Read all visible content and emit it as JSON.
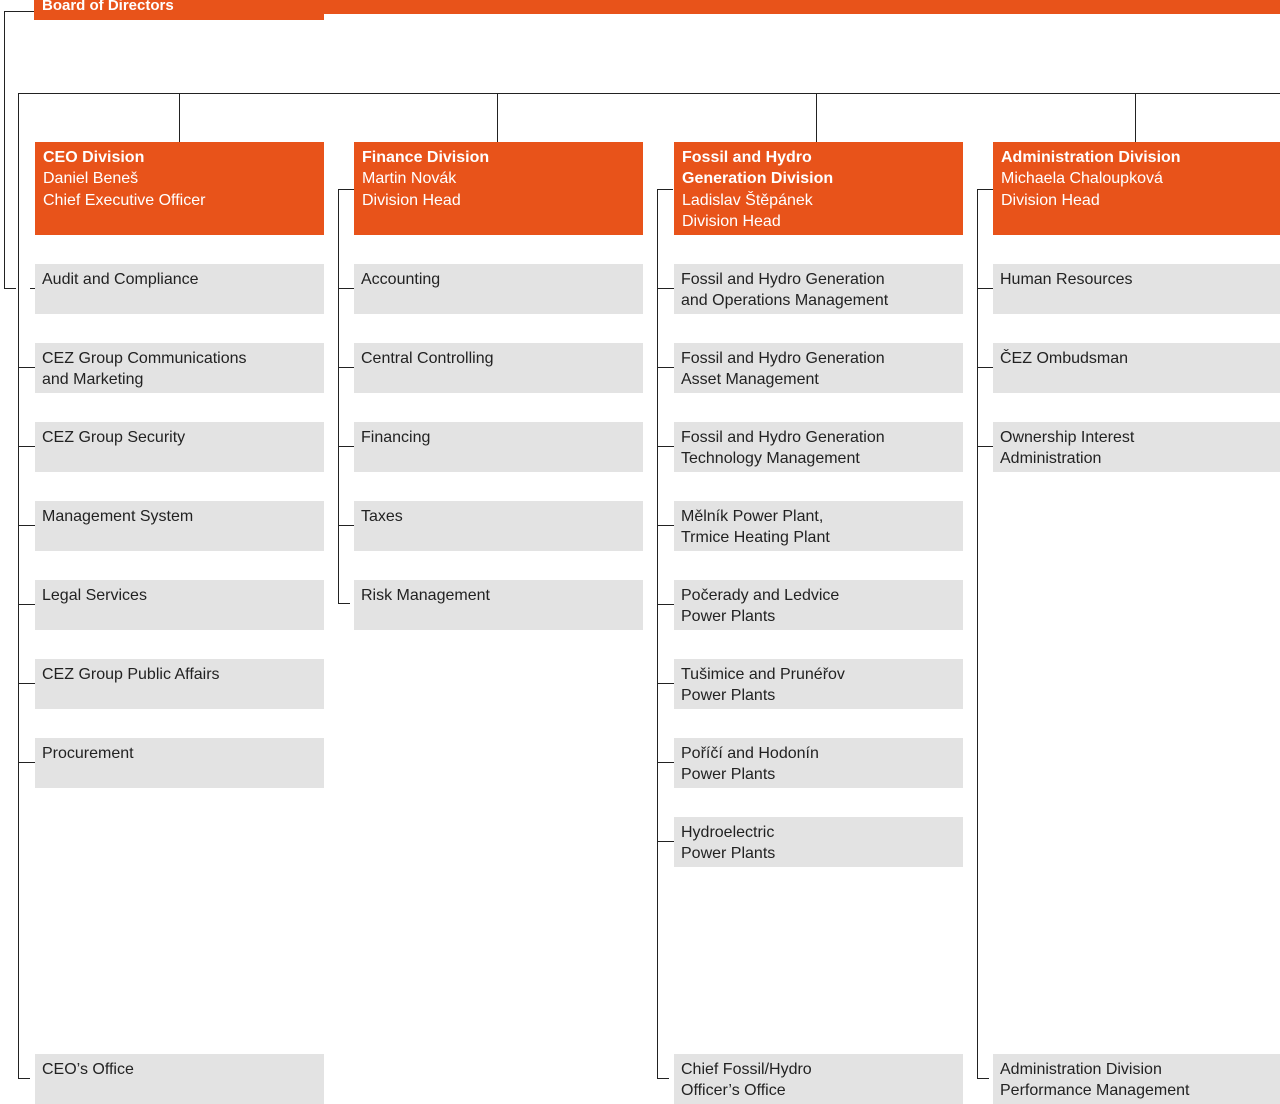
{
  "board": {
    "title": "Board of Directors"
  },
  "divisions": [
    {
      "title": "CEO Division",
      "person": "Daniel Beneš",
      "role": "Chief Executive Officer",
      "units": [
        "Audit and Compliance",
        "CEZ Group Communications\nand Marketing",
        "CEZ Group Security",
        "Management System",
        "Legal Services",
        "CEZ Group Public Affairs",
        "Procurement"
      ],
      "footer_unit": "CEO’s Office"
    },
    {
      "title": "Finance Division",
      "person": "Martin Novák",
      "role": "Division Head",
      "units": [
        "Accounting",
        "Central Controlling",
        "Financing",
        "Taxes",
        "Risk Management"
      ]
    },
    {
      "title": "Fossil and Hydro\nGeneration Division",
      "person": "Ladislav Štěpánek",
      "role": "Division Head",
      "units": [
        "Fossil and Hydro Generation\nand Operations Management",
        "Fossil and Hydro Generation\nAsset Management",
        "Fossil and Hydro Generation\nTechnology Management",
        "Mělník Power Plant,\nTrmice Heating Plant",
        "Počerady and Ledvice\nPower Plants",
        "Tušimice and Prunéřov\nPower Plants",
        "Poříčí and Hodonín\nPower Plants",
        "Hydroelectric\nPower Plants"
      ],
      "footer_unit": "Chief Fossil/Hydro\nOfficer’s Office"
    },
    {
      "title": "Administration Division",
      "person": "Michaela Chaloupková",
      "role": "Division Head",
      "units": [
        "Human Resources",
        "ČEZ Ombudsman",
        "Ownership Interest\nAdministration"
      ],
      "footer_unit": "Administration Division\nPerformance Management"
    }
  ]
}
